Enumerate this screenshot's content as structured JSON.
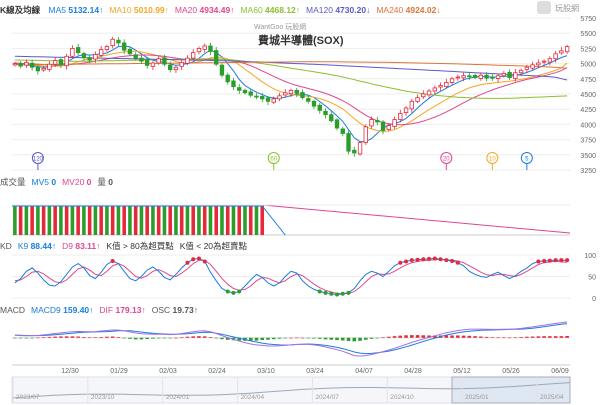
{
  "header": {
    "label": "K線及均線",
    "watermark": "WantGoo 玩股網",
    "title": "費城半導體(SOX)",
    "logo_text": "玩股網"
  },
  "ma_legend": [
    {
      "name": "MA5",
      "value": "5132.14↑",
      "color": "#1a7de0"
    },
    {
      "name": "MA10",
      "value": "5010.99↑",
      "color": "#f5a623"
    },
    {
      "name": "MA20",
      "value": "4934.49↑",
      "color": "#e0468f"
    },
    {
      "name": "MA60",
      "value": "4468.12↑",
      "color": "#8bbf2f"
    },
    {
      "name": "MA120",
      "value": "4730.20↓",
      "color": "#5a5acc"
    },
    {
      "name": "MA240",
      "value": "4924.02↓",
      "color": "#e0743a"
    }
  ],
  "volume_legend": [
    {
      "name": "成交量",
      "value": "",
      "color": "#555"
    },
    {
      "name": "MV5",
      "value": "0",
      "color": "#1a7de0"
    },
    {
      "name": "MV20",
      "value": "0",
      "color": "#e0468f"
    },
    {
      "name": "量",
      "value": "0",
      "color": "#555"
    }
  ],
  "kd_legend": [
    {
      "name": "KD",
      "value": "",
      "color": "#555"
    },
    {
      "name": "K9",
      "value": "88.44↑",
      "color": "#1a7de0"
    },
    {
      "name": "D9",
      "value": "83.11↑",
      "color": "#e0468f"
    },
    {
      "name": "K值 > 80為超買點",
      "value": "",
      "color": "#333"
    },
    {
      "name": "K值 < 20為超賣點",
      "value": "",
      "color": "#333"
    }
  ],
  "macd_legend": [
    {
      "name": "MACD",
      "value": "",
      "color": "#555"
    },
    {
      "name": "MACD9",
      "value": "159.40↑",
      "color": "#1a7de0"
    },
    {
      "name": "DIF",
      "value": "179.13↑",
      "color": "#e0468f"
    },
    {
      "name": "OSC",
      "value": "19.73↑",
      "color": "#555"
    }
  ],
  "colors": {
    "up": "#e5283a",
    "down": "#2a9d2a",
    "grid": "#eeeeee",
    "axis_text": "#666666"
  },
  "chart_data": {
    "type": "candlestick",
    "price_axis": {
      "ticks": [
        3250,
        3500,
        3750,
        4000,
        4250,
        4500,
        4750,
        5000,
        5250,
        5500,
        5750
      ],
      "ylim": [
        3250,
        5750
      ]
    },
    "date_labels": [
      "12/30",
      "01/29",
      "02/03",
      "02/24",
      "03/10",
      "03/24",
      "04/07",
      "04/28",
      "05/12",
      "05/26",
      "06/09"
    ],
    "nav_labels": [
      "2023/07",
      "2023/10",
      "2024/01",
      "2024/04",
      "2024/07",
      "2024/10",
      "2025/01",
      "2025/04"
    ],
    "close": [
      5000,
      4960,
      5020,
      4940,
      4880,
      4920,
      4990,
      5050,
      4980,
      5120,
      5250,
      5180,
      5100,
      5060,
      5150,
      5230,
      5280,
      5400,
      5340,
      5220,
      5160,
      5090,
      5040,
      4970,
      5010,
      5080,
      4990,
      4900,
      4940,
      5020,
      5090,
      5180,
      5250,
      5290,
      5200,
      4990,
      4810,
      4700,
      4620,
      4560,
      4520,
      4480,
      4460,
      4420,
      4380,
      4420,
      4470,
      4520,
      4560,
      4510,
      4440,
      4380,
      4300,
      4230,
      4160,
      4060,
      3940,
      3850,
      3560,
      3530,
      3700,
      3960,
      4080,
      4040,
      3900,
      3980,
      4080,
      4180,
      4270,
      4380,
      4440,
      4500,
      4550,
      4600,
      4640,
      4690,
      4750,
      4780,
      4800,
      4790,
      4770,
      4810,
      4760,
      4770,
      4800,
      4840,
      4770,
      4850,
      4890,
      4940,
      4980,
      5010,
      5040,
      5080,
      5160,
      5210,
      5280
    ],
    "ma": [
      {
        "name": "MA5",
        "values": [
          5000,
          4990,
          4975,
          4968,
          4950,
          4940,
          4945,
          4965,
          4975,
          5020,
          5080,
          5125,
          5150,
          5140,
          5150,
          5160,
          5175,
          5225,
          5280,
          5290,
          5275,
          5220,
          5160,
          5095,
          5055,
          5035,
          5020,
          4995,
          4970,
          4985,
          5000,
          5030,
          5085,
          5165,
          5220,
          5180,
          5110,
          5000,
          4880,
          4740,
          4640,
          4580,
          4530,
          4490,
          4450,
          4435,
          4430,
          4445,
          4475,
          4495,
          4500,
          4480,
          4440,
          4375,
          4305,
          4225,
          4140,
          4050,
          3915,
          3780,
          3715,
          3720,
          3765,
          3855,
          3935,
          3995,
          4015,
          4045,
          4100,
          4180,
          4270,
          4355,
          4430,
          4495,
          4545,
          4595,
          4645,
          4690,
          4735,
          4760,
          4780,
          4790,
          4785,
          4780,
          4780,
          4795,
          4790,
          4805,
          4825,
          4855,
          4890,
          4935,
          4970,
          5010,
          5055,
          5100,
          5132
        ]
      },
      {
        "name": "MA10",
        "values": [
          5000,
          4995,
          4985,
          4980,
          4970,
          4962,
          4958,
          4958,
          4960,
          4975,
          4998,
          5030,
          5058,
          5080,
          5100,
          5120,
          5140,
          5162,
          5180,
          5190,
          5200,
          5200,
          5190,
          5170,
          5150,
          5125,
          5095,
          5065,
          5035,
          5015,
          5010,
          5015,
          5030,
          5060,
          5095,
          5110,
          5100,
          5075,
          5035,
          4980,
          4910,
          4840,
          4770,
          4700,
          4640,
          4585,
          4545,
          4515,
          4495,
          4480,
          4470,
          4460,
          4445,
          4425,
          4395,
          4355,
          4310,
          4255,
          4175,
          4095,
          4020,
          3960,
          3925,
          3900,
          3885,
          3890,
          3915,
          3955,
          4005,
          4060,
          4120,
          4185,
          4245,
          4300,
          4355,
          4410,
          4465,
          4515,
          4560,
          4600,
          4630,
          4655,
          4670,
          4680,
          4690,
          4700,
          4710,
          4725,
          4740,
          4760,
          4780,
          4805,
          4830,
          4860,
          4890,
          4930,
          5011
        ]
      },
      {
        "name": "MA20",
        "values": [
          5010,
          5005,
          5000,
          4995,
          4990,
          4985,
          4982,
          4980,
          4980,
          4982,
          4988,
          4998,
          5010,
          5025,
          5040,
          5058,
          5075,
          5092,
          5108,
          5120,
          5130,
          5138,
          5142,
          5142,
          5138,
          5130,
          5118,
          5105,
          5090,
          5078,
          5068,
          5062,
          5060,
          5062,
          5068,
          5072,
          5070,
          5062,
          5048,
          5028,
          5000,
          4965,
          4925,
          4880,
          4835,
          4790,
          4745,
          4705,
          4670,
          4640,
          4615,
          4590,
          4565,
          4540,
          4510,
          4475,
          4435,
          4390,
          4335,
          4275,
          4210,
          4150,
          4100,
          4060,
          4030,
          4010,
          3998,
          3995,
          4000,
          4012,
          4030,
          4055,
          4085,
          4120,
          4160,
          4205,
          4255,
          4305,
          4355,
          4405,
          4450,
          4490,
          4530,
          4565,
          4600,
          4630,
          4660,
          4690,
          4715,
          4740,
          4760,
          4780,
          4800,
          4825,
          4850,
          4885,
          4934
        ]
      },
      {
        "name": "MA60",
        "values": [
          5060,
          5058,
          5056,
          5054,
          5052,
          5050,
          5048,
          5046,
          5044,
          5042,
          5040,
          5040,
          5040,
          5041,
          5042,
          5044,
          5046,
          5048,
          5050,
          5052,
          5054,
          5056,
          5058,
          5060,
          5062,
          5064,
          5066,
          5068,
          5070,
          5072,
          5074,
          5076,
          5078,
          5080,
          5080,
          5078,
          5074,
          5068,
          5060,
          5050,
          5040,
          5028,
          5015,
          5000,
          4985,
          4970,
          4955,
          4940,
          4925,
          4910,
          4895,
          4880,
          4865,
          4850,
          4835,
          4818,
          4800,
          4780,
          4758,
          4735,
          4712,
          4690,
          4668,
          4646,
          4625,
          4605,
          4585,
          4566,
          4548,
          4532,
          4518,
          4505,
          4493,
          4482,
          4472,
          4463,
          4455,
          4448,
          4442,
          4437,
          4433,
          4430,
          4428,
          4427,
          4427,
          4428,
          4430,
          4433,
          4437,
          4441,
          4445,
          4449,
          4453,
          4457,
          4461,
          4465,
          4468
        ]
      },
      {
        "name": "MA120",
        "values": [
          5120,
          5118,
          5116,
          5114,
          5112,
          5110,
          5108,
          5106,
          5104,
          5102,
          5100,
          5098,
          5096,
          5094,
          5092,
          5090,
          5088,
          5086,
          5084,
          5082,
          5080,
          5078,
          5076,
          5074,
          5072,
          5070,
          5068,
          5066,
          5064,
          5062,
          5060,
          5058,
          5056,
          5054,
          5052,
          5050,
          5047,
          5044,
          5041,
          5038,
          5035,
          5032,
          5028,
          5024,
          5020,
          5016,
          5012,
          5008,
          5004,
          5000,
          4996,
          4992,
          4988,
          4984,
          4980,
          4976,
          4971,
          4966,
          4961,
          4956,
          4951,
          4946,
          4941,
          4936,
          4931,
          4926,
          4921,
          4916,
          4911,
          4906,
          4901,
          4896,
          4891,
          4886,
          4881,
          4876,
          4871,
          4866,
          4861,
          4856,
          4851,
          4846,
          4841,
          4836,
          4831,
          4826,
          4821,
          4816,
          4811,
          4806,
          4801,
          4796,
          4790,
          4784,
          4774,
          4752,
          4730
        ]
      },
      {
        "name": "MA240",
        "values": [
          4980,
          4981,
          4982,
          4983,
          4984,
          4985,
          4986,
          4987,
          4988,
          4989,
          4990,
          4991,
          4992,
          4993,
          4994,
          4995,
          4996,
          4997,
          4998,
          4999,
          5000,
          5001,
          5002,
          5003,
          5004,
          5005,
          5006,
          5007,
          5008,
          5009,
          5010,
          5011,
          5012,
          5013,
          5014,
          5015,
          5016,
          5017,
          5018,
          5019,
          5020,
          5021,
          5022,
          5023,
          5024,
          5025,
          5026,
          5027,
          5028,
          5029,
          5030,
          5030,
          5030,
          5030,
          5030,
          5030,
          5029,
          5028,
          5027,
          5026,
          5025,
          5024,
          5023,
          5022,
          5021,
          5020,
          5018,
          5016,
          5014,
          5012,
          5010,
          5008,
          5006,
          5004,
          5002,
          5000,
          4998,
          4995,
          4992,
          4989,
          4986,
          4983,
          4980,
          4977,
          4974,
          4971,
          4968,
          4965,
          4962,
          4959,
          4956,
          4952,
          4948,
          4944,
          4938,
          4931,
          4924
        ]
      }
    ],
    "markers": [
      {
        "label": "120",
        "value": 5000,
        "index": 4,
        "color": "#5a5acc"
      },
      {
        "label": "60",
        "value": 5400,
        "index": 45,
        "color": "#8bbf2f"
      },
      {
        "label": "20",
        "value": 4900,
        "index": 75,
        "color": "#e0468f"
      },
      {
        "label": "10",
        "value": 5000,
        "index": 83,
        "color": "#f5a623"
      },
      {
        "label": "5",
        "value": 5050,
        "index": 89,
        "color": "#1a7de0"
      }
    ],
    "volume": {
      "bar_count": 44,
      "level": 1.0,
      "mv20_start": 1.0
    },
    "kd": {
      "ylim": [
        0,
        100
      ],
      "ticks": [
        0,
        50,
        100
      ],
      "k": [
        35,
        45,
        62,
        70,
        58,
        42,
        30,
        28,
        38,
        55,
        72,
        80,
        70,
        52,
        45,
        60,
        78,
        86,
        80,
        62,
        45,
        40,
        50,
        65,
        72,
        62,
        48,
        42,
        55,
        70,
        82,
        90,
        92,
        85,
        60,
        40,
        22,
        15,
        12,
        15,
        28,
        42,
        55,
        48,
        35,
        28,
        35,
        50,
        62,
        58,
        40,
        28,
        20,
        15,
        12,
        10,
        8,
        10,
        12,
        22,
        40,
        55,
        62,
        58,
        50,
        62,
        75,
        82,
        85,
        88,
        89,
        90,
        91,
        92,
        90,
        88,
        86,
        82,
        75,
        62,
        55,
        50,
        48,
        55,
        60,
        52,
        45,
        52,
        62,
        70,
        80,
        85,
        86,
        87,
        88,
        88,
        88
      ],
      "d": [
        40,
        42,
        50,
        60,
        62,
        56,
        46,
        38,
        35,
        42,
        55,
        68,
        72,
        65,
        55,
        52,
        62,
        75,
        80,
        74,
        62,
        50,
        46,
        52,
        62,
        66,
        60,
        52,
        50,
        58,
        68,
        80,
        88,
        88,
        78,
        62,
        45,
        32,
        22,
        18,
        20,
        28,
        40,
        48,
        46,
        40,
        35,
        40,
        50,
        56,
        52,
        42,
        32,
        24,
        18,
        14,
        11,
        10,
        11,
        15,
        25,
        38,
        50,
        56,
        55,
        56,
        62,
        70,
        77,
        82,
        85,
        87,
        88,
        89,
        90,
        89,
        88,
        86,
        82,
        75,
        68,
        60,
        54,
        52,
        55,
        55,
        52,
        50,
        55,
        62,
        70,
        78,
        82,
        84,
        85,
        84,
        83
      ]
    },
    "macd": {
      "zero": 0,
      "ylim": [
        -250,
        200
      ],
      "macd9": [
        30,
        28,
        26,
        25,
        24,
        26,
        30,
        35,
        40,
        46,
        52,
        58,
        62,
        64,
        66,
        68,
        70,
        74,
        78,
        80,
        78,
        72,
        64,
        56,
        50,
        46,
        42,
        40,
        40,
        42,
        46,
        52,
        58,
        62,
        60,
        52,
        40,
        25,
        10,
        -5,
        -20,
        -35,
        -48,
        -60,
        -70,
        -76,
        -80,
        -82,
        -80,
        -76,
        -72,
        -70,
        -72,
        -78,
        -86,
        -96,
        -108,
        -122,
        -140,
        -160,
        -172,
        -178,
        -176,
        -168,
        -160,
        -150,
        -136,
        -120,
        -102,
        -82,
        -62,
        -42,
        -22,
        -4,
        14,
        30,
        44,
        56,
        66,
        74,
        80,
        84,
        86,
        88,
        90,
        92,
        94,
        96,
        98,
        102,
        108,
        116,
        124,
        134,
        144,
        152,
        159
      ],
      "dif": [
        28,
        24,
        22,
        24,
        26,
        32,
        40,
        48,
        55,
        62,
        68,
        72,
        70,
        68,
        70,
        76,
        82,
        88,
        86,
        78,
        66,
        54,
        46,
        42,
        40,
        40,
        38,
        36,
        40,
        48,
        58,
        68,
        76,
        78,
        68,
        48,
        24,
        2,
        -18,
        -36,
        -54,
        -70,
        -80,
        -86,
        -92,
        -92,
        -90,
        -86,
        -80,
        -74,
        -72,
        -74,
        -80,
        -90,
        -104,
        -118,
        -134,
        -152,
        -176,
        -200,
        -206,
        -200,
        -188,
        -172,
        -156,
        -138,
        -118,
        -96,
        -74,
        -52,
        -32,
        -14,
        4,
        22,
        40,
        56,
        70,
        82,
        90,
        96,
        98,
        98,
        96,
        94,
        94,
        96,
        96,
        100,
        106,
        114,
        122,
        132,
        142,
        152,
        162,
        170,
        179
      ]
    }
  }
}
